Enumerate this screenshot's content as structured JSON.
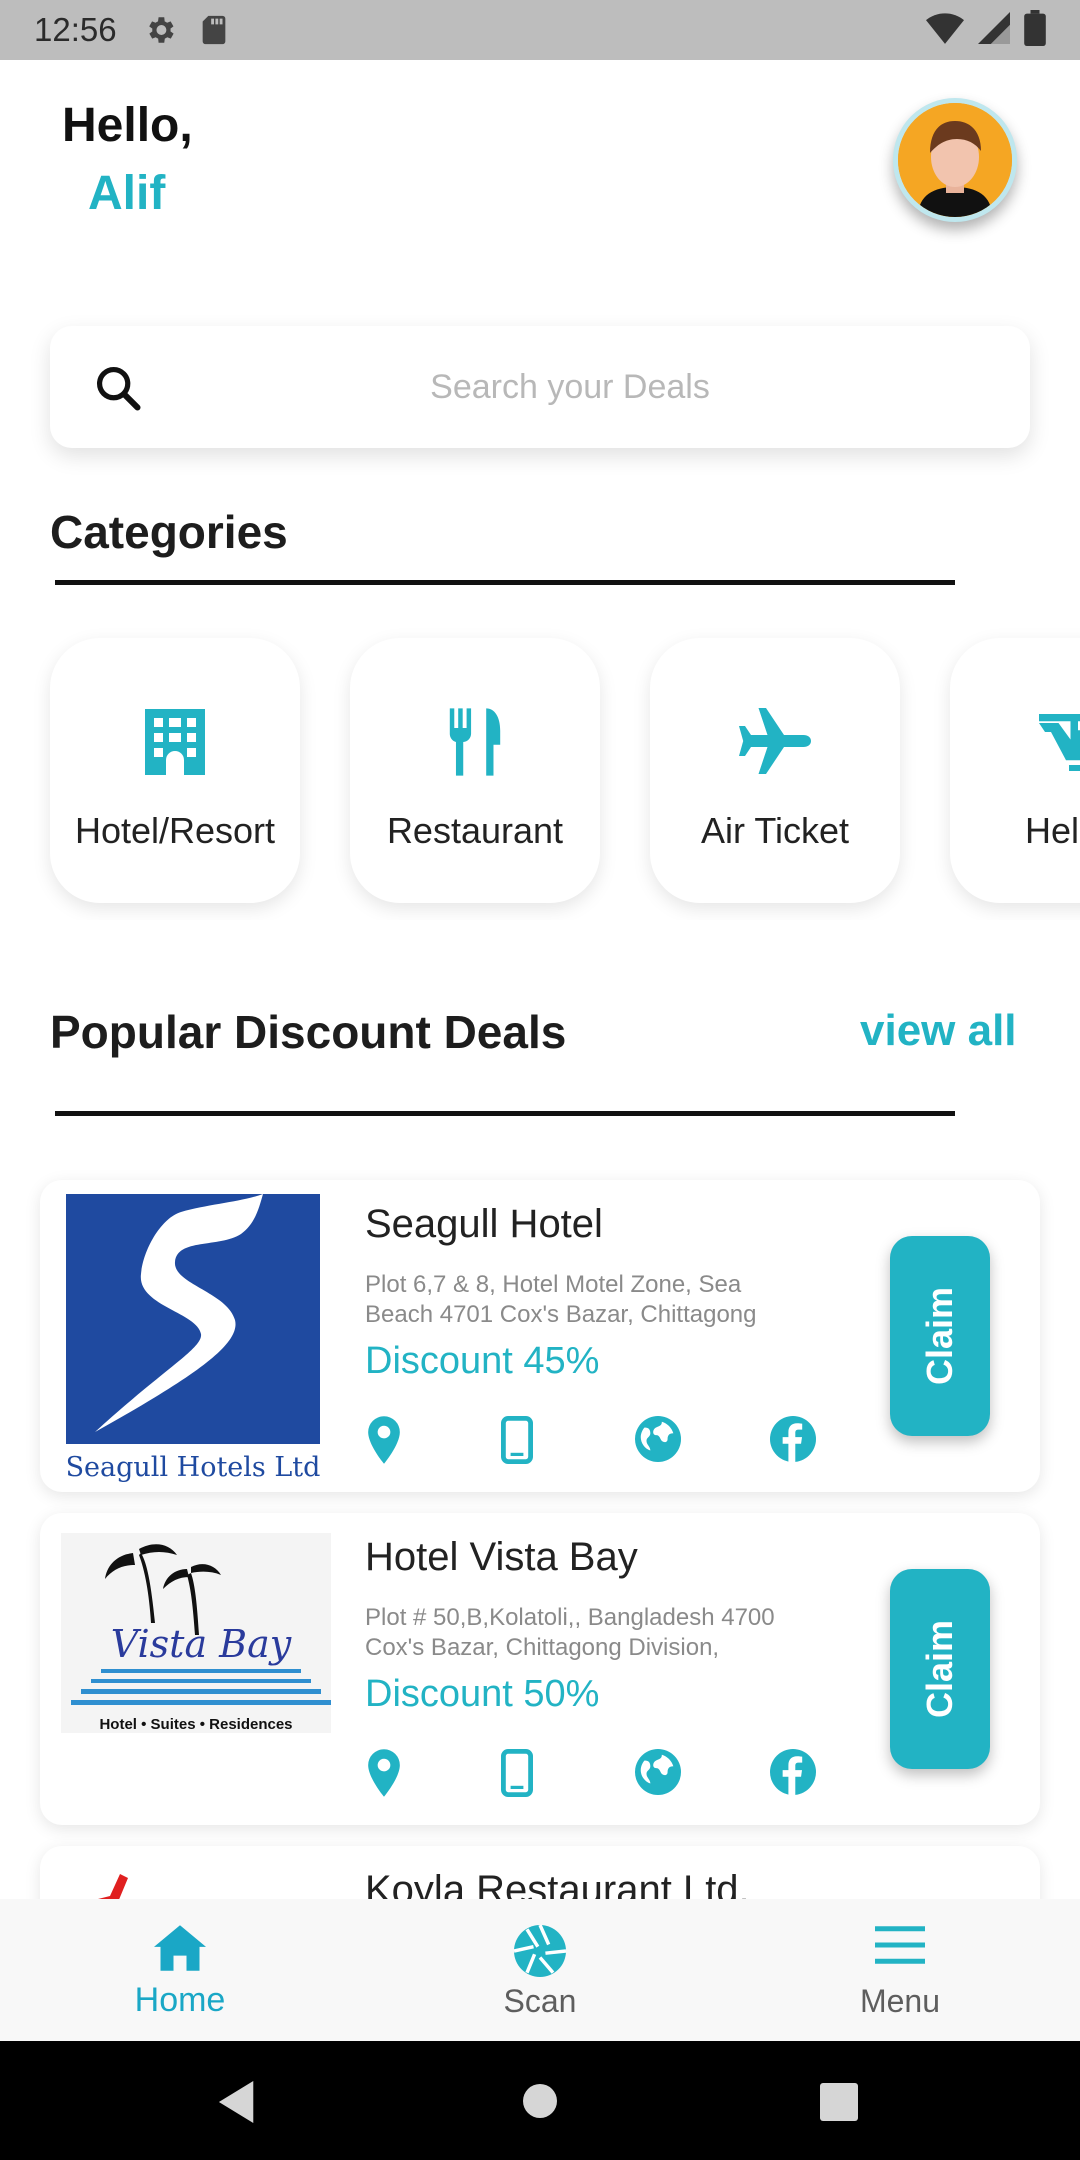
{
  "status_bar": {
    "time": "12:56"
  },
  "greeting": {
    "hello": "Hello,",
    "name": "Alif"
  },
  "search": {
    "placeholder": "Search your Deals"
  },
  "categories": {
    "title": "Categories",
    "items": [
      {
        "label": "Hotel/Resort",
        "icon": "building-icon"
      },
      {
        "label": "Restaurant",
        "icon": "fork-knife-icon"
      },
      {
        "label": "Air Ticket",
        "icon": "airplane-icon"
      },
      {
        "label": "Helico",
        "icon": "helicopter-icon"
      }
    ]
  },
  "deals": {
    "title": "Popular Discount Deals",
    "view_all": "view all",
    "items": [
      {
        "name": "Seagull Hotel",
        "address": "Plot 6,7 & 8, Hotel Motel Zone, Sea Beach 4701 Cox's Bazar, Chittagong",
        "discount": "Discount 45%",
        "logo_text": "Seagull Hotels Ltd",
        "claim": "Claim"
      },
      {
        "name": "Hotel Vista Bay",
        "address": "Plot # 50,B,Kolatoli,, Bangladesh 4700 Cox's Bazar, Chittagong Division,",
        "discount": "Discount 50%",
        "logo_text": "Vista Bay",
        "logo_subtext": "Hotel • Suites • Residences",
        "claim": "Claim"
      },
      {
        "name": "Koyla Restaurant Ltd."
      }
    ]
  },
  "bottom_nav": {
    "home": "Home",
    "scan": "Scan",
    "menu": "Menu"
  },
  "colors": {
    "accent": "#22b3c4",
    "nav_active": "#1aa7c6",
    "seagull_blue": "#1f4aa0"
  }
}
